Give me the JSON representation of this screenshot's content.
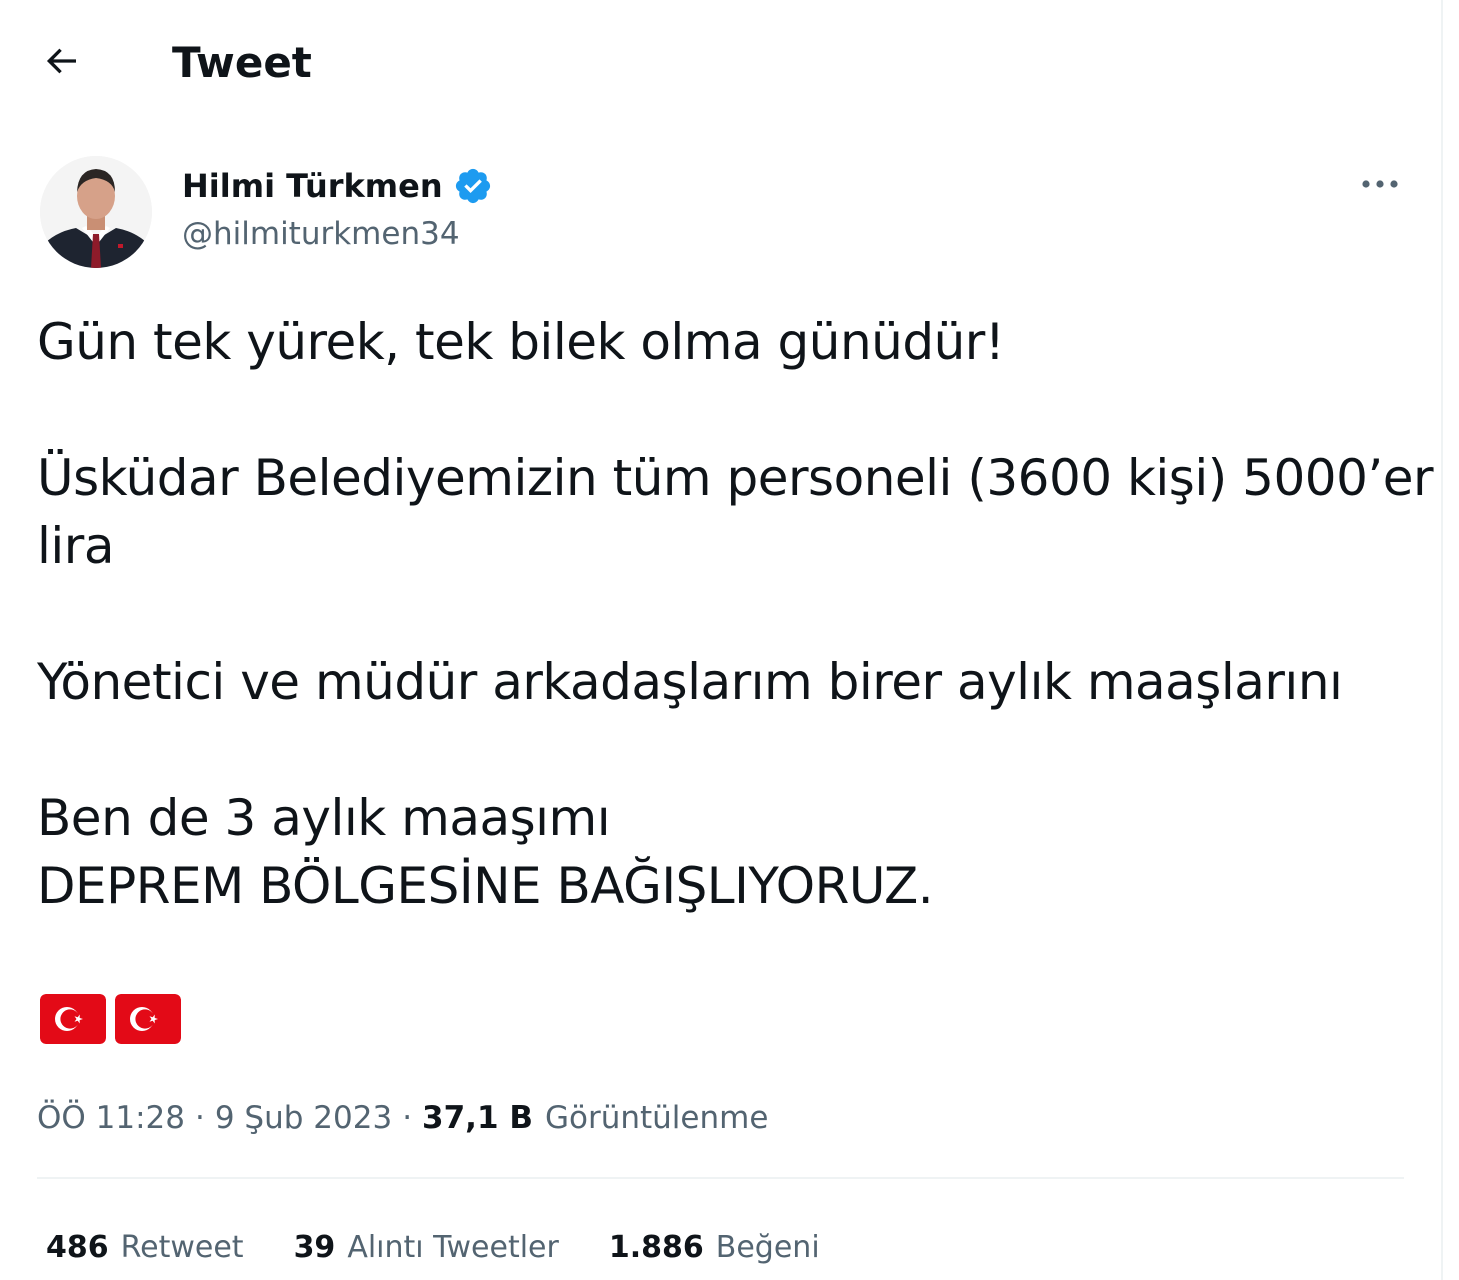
{
  "header": {
    "title": "Tweet",
    "back_icon": "arrow-left-icon"
  },
  "author": {
    "name": "Hilmi Türkmen",
    "handle": "@hilmiturkmen34",
    "verified": true,
    "verified_color": "#1d9bf0"
  },
  "tweet": {
    "lines": [
      "Gün tek yürek, tek bilek olma günüdür!",
      "Üsküdar Belediyemizin tüm personeli (3600 kişi) 5000’er",
      "lira",
      "Yönetici ve müdür arkadaşlarım birer aylık maaşlarını",
      "Ben de 3 aylık maaşımı",
      "DEPREM BÖLGESİNE BAĞIŞLIYORUZ."
    ],
    "emojis": [
      "turkish-flag",
      "turkish-flag"
    ]
  },
  "meta": {
    "time": "ÖÖ 11:28",
    "separator": "·",
    "date": "9 Şub 2023",
    "views_count": "37,1 B",
    "views_label": "Görüntülenme"
  },
  "stats": {
    "retweets_count": "486",
    "retweets_label": "Retweet",
    "quotes_count": "39",
    "quotes_label": "Alıntı Tweetler",
    "likes_count": "1.886",
    "likes_label": "Beğeni"
  },
  "colors": {
    "text_primary": "#0f1419",
    "text_secondary": "#536471",
    "flag_red": "#e30a17",
    "divider": "#eff3f4"
  }
}
